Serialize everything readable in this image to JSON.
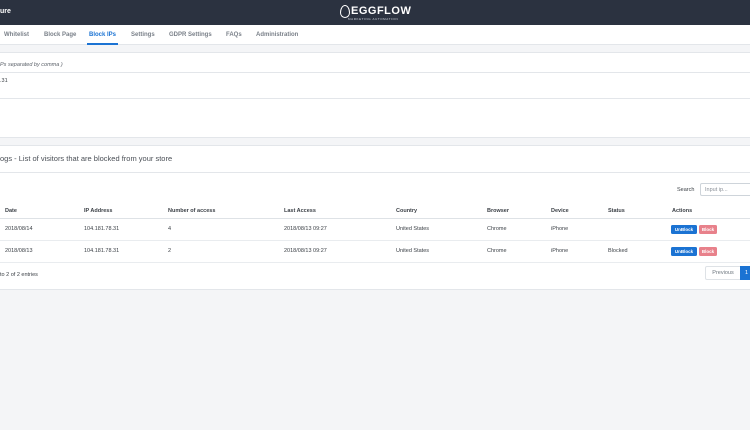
{
  "header": {
    "app_name": "ure",
    "logo_brand": "EGGFLOW",
    "logo_tagline": "MARKETING AUTOMATION"
  },
  "tabs": [
    {
      "label": "Whitelist"
    },
    {
      "label": "Block Page"
    },
    {
      "label": "Block IPs",
      "active": true
    },
    {
      "label": "Settings"
    },
    {
      "label": "GDPR Settings"
    },
    {
      "label": "FAQs"
    },
    {
      "label": "Administration"
    }
  ],
  "ip_form": {
    "hint": "Ps separated by comma )",
    "value": ".31"
  },
  "logs": {
    "heading": "ogs - List of visitors that are blocked from your store",
    "search_label": "Search",
    "search_placeholder": "Input ip...",
    "columns": [
      "Date",
      "IP Address",
      "Number of access",
      "Last Access",
      "Country",
      "Browser",
      "Device",
      "Status",
      "Actions"
    ],
    "rows": [
      {
        "date": "2018/08/14",
        "ip": "104.181.78.31",
        "count": "4",
        "last_access": "2018/08/13 09:27",
        "country": "United States",
        "browser": "Chrome",
        "device": "iPhone",
        "status": ""
      },
      {
        "date": "2018/08/13",
        "ip": "104.181.78.31",
        "count": "2",
        "last_access": "2018/08/13 09:27",
        "country": "United States",
        "browser": "Chrome",
        "device": "iPhone",
        "status": "Blocked"
      }
    ],
    "unblock_label": "UnBlock",
    "block_label": "Block",
    "info": "to 2 of 2 entries",
    "prev_label": "Previous",
    "page_label": "1"
  }
}
